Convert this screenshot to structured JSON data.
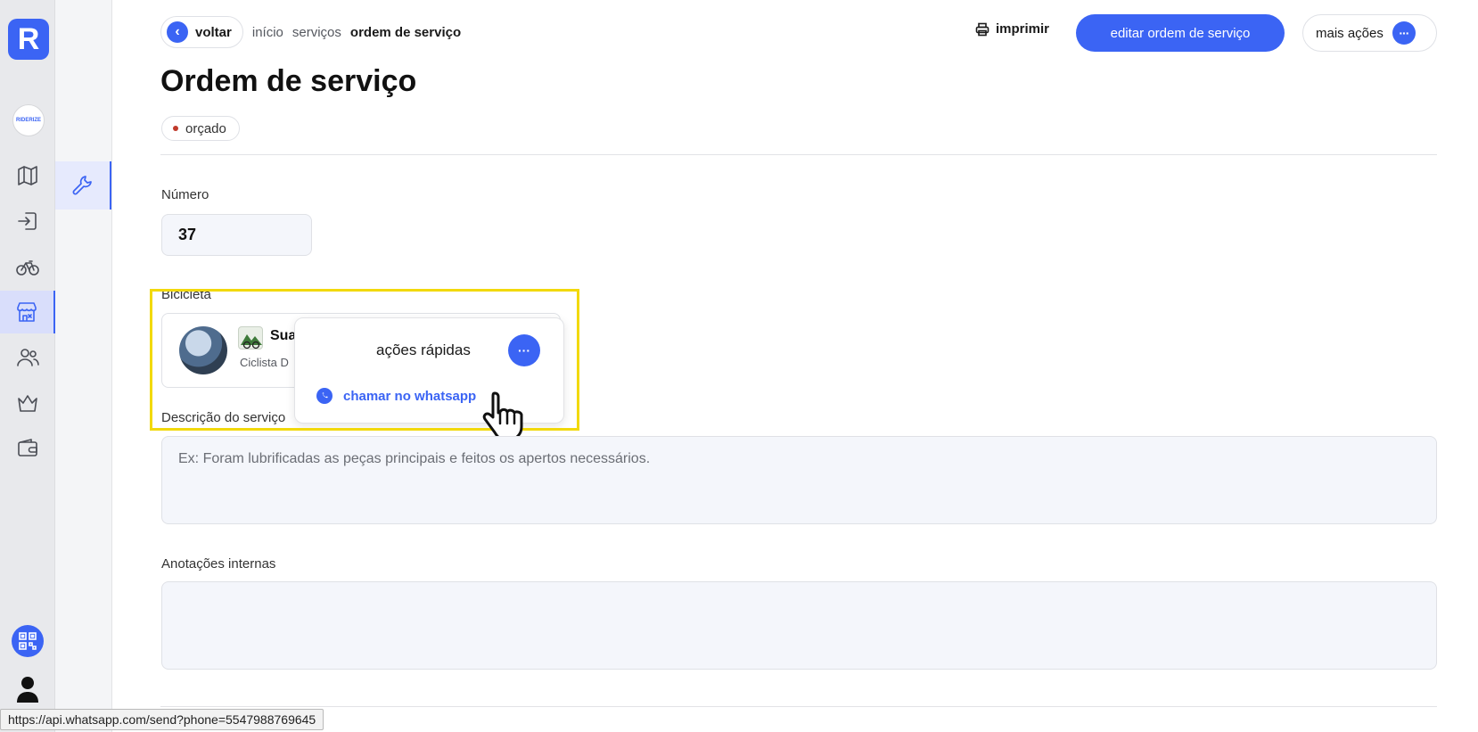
{
  "app": {
    "logo_letter": "R",
    "org_name": "RIDERIZE"
  },
  "breadcrumb": {
    "back_label": "voltar",
    "items": [
      "início",
      "serviços"
    ],
    "current": "ordem de serviço"
  },
  "toolbar": {
    "print_label": "imprimir",
    "edit_label": "editar ordem de serviço",
    "more_label": "mais ações",
    "dots": "···"
  },
  "page": {
    "title": "Ordem de serviço",
    "status": "orçado"
  },
  "form": {
    "number_label": "Número",
    "number_value": "37",
    "bike_label": "Bicicleta",
    "bike_name": "Sua",
    "bike_sub": "Ciclista D",
    "description_label": "Descrição do serviço",
    "description_placeholder": "Ex: Foram lubrificadas as peças principais e feitos os apertos necessários.",
    "notes_label": "Anotações internas",
    "notes_value": ""
  },
  "popup": {
    "title": "ações rápidas",
    "item": "chamar no whatsapp",
    "dots": "···"
  },
  "statusbar": {
    "url": "https://api.whatsapp.com/send?phone=5547988769645"
  },
  "colors": {
    "accent": "#3b64f4",
    "highlight": "#f2d90c",
    "status_dot": "#c0392b"
  },
  "icons": [
    "map-icon",
    "login-icon",
    "bicycle-icon",
    "store-icon",
    "users-icon",
    "crown-icon",
    "wallet-icon",
    "wrench-icon",
    "printer-icon",
    "whatsapp-icon",
    "qr-code-icon",
    "user-icon",
    "chevron-left-icon",
    "hand-cursor-icon"
  ]
}
